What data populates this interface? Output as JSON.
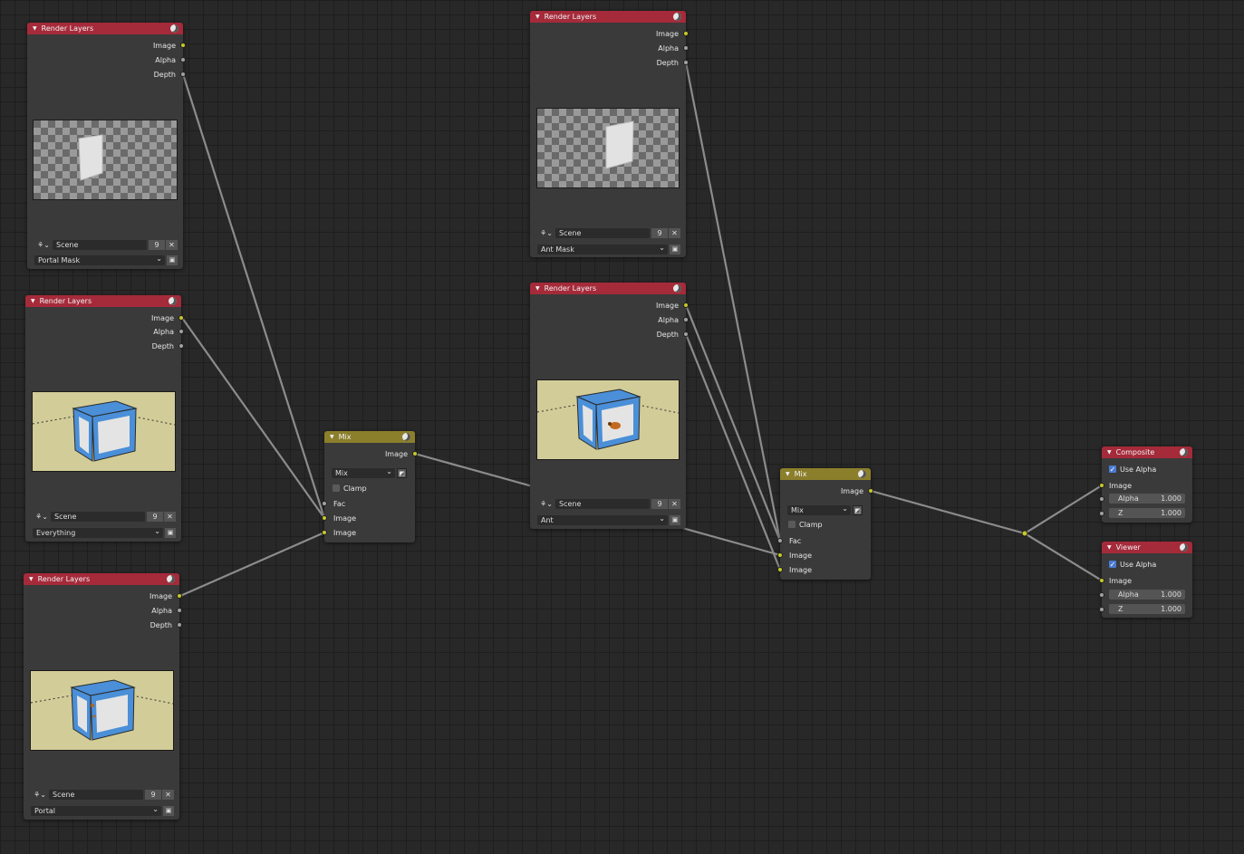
{
  "render_layers": [
    {
      "title": "Render Layers",
      "outputs": [
        "Image",
        "Alpha",
        "Depth"
      ],
      "scene": "Scene",
      "scene_num": "9",
      "layer": "Portal Mask",
      "preview": "mask"
    },
    {
      "title": "Render Layers",
      "outputs": [
        "Image",
        "Alpha",
        "Depth"
      ],
      "scene": "Scene",
      "scene_num": "9",
      "layer": "Everything",
      "preview": "cube"
    },
    {
      "title": "Render Layers",
      "outputs": [
        "Image",
        "Alpha",
        "Depth"
      ],
      "scene": "Scene",
      "scene_num": "9",
      "layer": "Portal",
      "preview": "cube"
    },
    {
      "title": "Render Layers",
      "outputs": [
        "Image",
        "Alpha",
        "Depth"
      ],
      "scene": "Scene",
      "scene_num": "9",
      "layer": "Ant Mask",
      "preview": "mask"
    },
    {
      "title": "Render Layers",
      "outputs": [
        "Image",
        "Alpha",
        "Depth"
      ],
      "scene": "Scene",
      "scene_num": "9",
      "layer": "Ant",
      "preview": "cube-ant"
    }
  ],
  "mix_nodes": [
    {
      "title": "Mix",
      "output": "Image",
      "blend": "Mix",
      "clamp_label": "Clamp",
      "inputs": [
        "Fac",
        "Image",
        "Image"
      ]
    },
    {
      "title": "Mix",
      "output": "Image",
      "blend": "Mix",
      "clamp_label": "Clamp",
      "inputs": [
        "Fac",
        "Image",
        "Image"
      ]
    }
  ],
  "composite": {
    "title": "Composite",
    "use_alpha": "Use Alpha",
    "image": "Image",
    "alpha_label": "Alpha",
    "alpha_value": "1.000",
    "z_label": "Z",
    "z_value": "1.000"
  },
  "viewer": {
    "title": "Viewer",
    "use_alpha": "Use Alpha",
    "image": "Image",
    "alpha_label": "Alpha",
    "alpha_value": "1.000",
    "z_label": "Z",
    "z_value": "1.000"
  },
  "colors": {
    "render_header": "#a52a3a",
    "mix_header": "#8b7f2b",
    "socket_image": "#c7c729",
    "socket_value": "#a1a1a1",
    "link": "#8a8a8a"
  }
}
